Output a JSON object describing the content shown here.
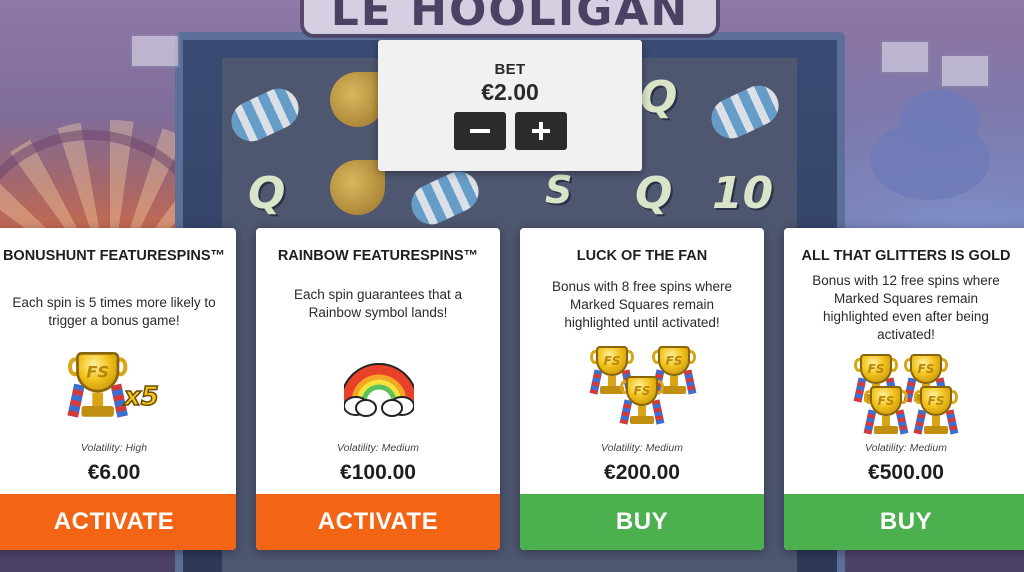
{
  "bet": {
    "label": "BET",
    "value": "€2.00"
  },
  "cards": [
    {
      "title": "BONUSHUNT FEATURESPINS™",
      "description": "Each spin is 5 times more likely to trigger a bonus game!",
      "art_text": "x5",
      "volatility": "Volatility: High",
      "price": "€6.00",
      "button": "ACTIVATE",
      "button_color": "#f36414"
    },
    {
      "title": "RAINBOW FEATURESPINS™",
      "description": "Each spin guarantees that a Rainbow symbol lands!",
      "volatility": "Volatility: Medium",
      "price": "€100.00",
      "button": "ACTIVATE",
      "button_color": "#f36414"
    },
    {
      "title": "LUCK OF THE FAN",
      "description": "Bonus with 8 free spins where Marked Squares remain highlighted until activated!",
      "volatility": "Volatility: Medium",
      "price": "€200.00",
      "button": "BUY",
      "button_color": "#4db04f"
    },
    {
      "title": "ALL THAT GLITTERS IS GOLD",
      "description": "Bonus with 12 free spins where Marked Squares remain highlighted even after being activated!",
      "volatility": "Volatility: Medium",
      "price": "€500.00",
      "button": "BUY",
      "button_color": "#4db04f"
    }
  ],
  "background": {
    "game_title": "LE HOOLIGAN",
    "reel_symbols": [
      "Q",
      "Q",
      "Q",
      "10",
      "S"
    ]
  }
}
